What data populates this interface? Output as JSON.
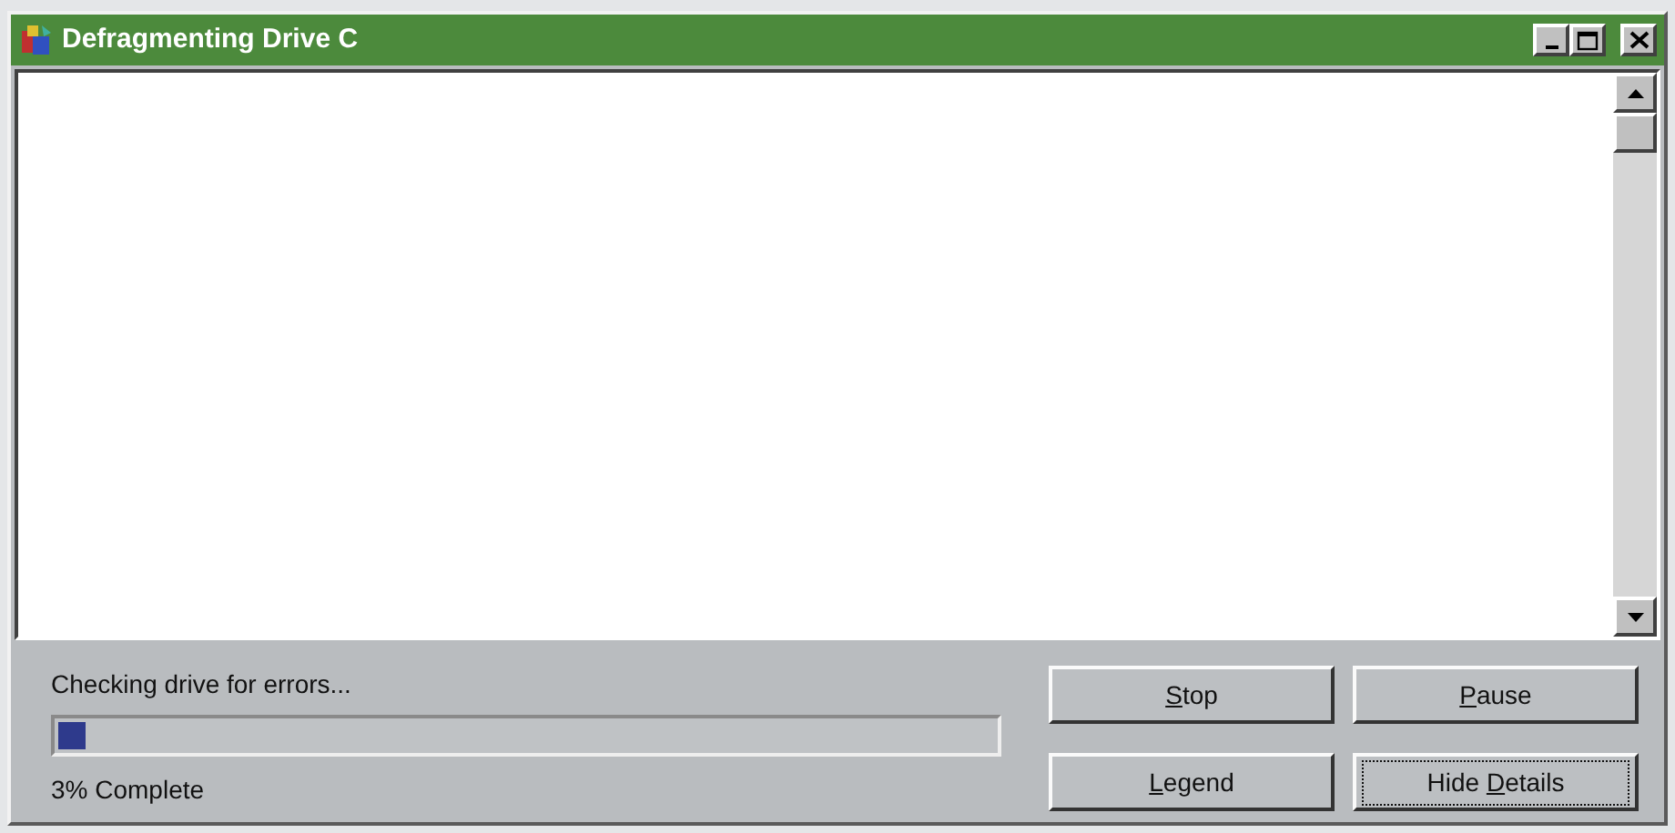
{
  "window": {
    "title": "Defragmenting Drive C"
  },
  "status": {
    "message": "Checking drive for errors...",
    "level": 0.03,
    "reading": "3% Complete"
  },
  "buttons": [
    {
      "label": [
        {
          "text": "S",
          "underlined": true
        },
        {
          "text": "top",
          "underlined": false
        }
      ],
      "focused": false
    },
    {
      "label": [
        {
          "text": "P",
          "underlined": true
        },
        {
          "text": "ause",
          "underlined": false
        }
      ],
      "focused": false
    },
    {
      "label": [
        {
          "text": "L",
          "underlined": true
        },
        {
          "text": "egend",
          "underlined": false
        }
      ],
      "focused": false
    },
    {
      "label": [
        {
          "text": "Hide ",
          "underlined": false
        },
        {
          "text": "D",
          "underlined": true
        },
        {
          "text": "etails",
          "underlined": false
        }
      ],
      "focused": true
    }
  ]
}
